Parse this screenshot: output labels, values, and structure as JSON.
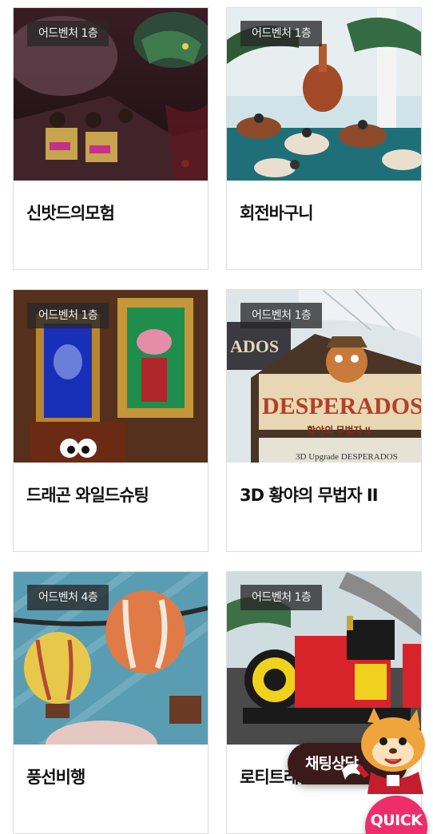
{
  "attractions": [
    {
      "floor": "어드벤처 1층",
      "name": "신밧드의모험"
    },
    {
      "floor": "어드벤처 1층",
      "name": "회전바구니"
    },
    {
      "floor": "어드벤처 1층",
      "name": "드래곤 와일드슈팅"
    },
    {
      "floor": "어드벤처 1층",
      "name": "3D 황야의 무법자 II"
    },
    {
      "floor": "어드벤처 4층",
      "name": "풍선비행"
    },
    {
      "floor": "어드벤처 1층",
      "name": "로티트레인"
    }
  ],
  "floating": {
    "chat_label": "채팅상담",
    "quick_label": "QUICK"
  },
  "image_text": {
    "desperado_sign": "DESPERADOS",
    "desperado_sub": "황야의 무법자 II",
    "desperado_caption": "3D Upgrade DESPERADOS",
    "ados_sign": "ADOS"
  },
  "colors": {
    "quick": "#ee2d6c",
    "chat": "#3a1a1a"
  }
}
